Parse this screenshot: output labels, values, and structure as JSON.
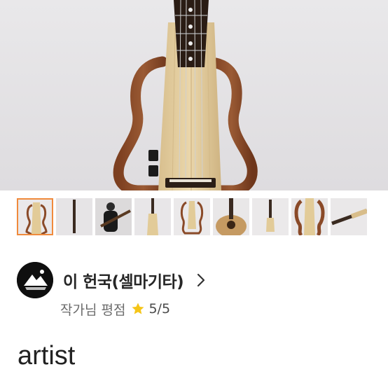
{
  "thumbnails": [
    {
      "icon": "guitar-front-thumb",
      "selected": true
    },
    {
      "icon": "guitar-neck-thumb",
      "selected": false
    },
    {
      "icon": "guitar-player-thumb",
      "selected": false
    },
    {
      "icon": "guitar-body-thumb",
      "selected": false
    },
    {
      "icon": "guitar-frame-thumb",
      "selected": false
    },
    {
      "icon": "guitar-headstock-thumb",
      "selected": false
    },
    {
      "icon": "guitar-side-thumb",
      "selected": false
    },
    {
      "icon": "guitar-frame-closeup-thumb",
      "selected": false
    },
    {
      "icon": "guitar-diagonal-thumb",
      "selected": false
    }
  ],
  "seller": {
    "name": "이 헌국(셀마기타)",
    "rating_label": "작가님 평점",
    "rating_value": "5/5",
    "star_color": "#f5c518"
  },
  "section_title": "artist",
  "colors": {
    "selected_border": "#f08a3c",
    "background": "#e7e6e8"
  }
}
